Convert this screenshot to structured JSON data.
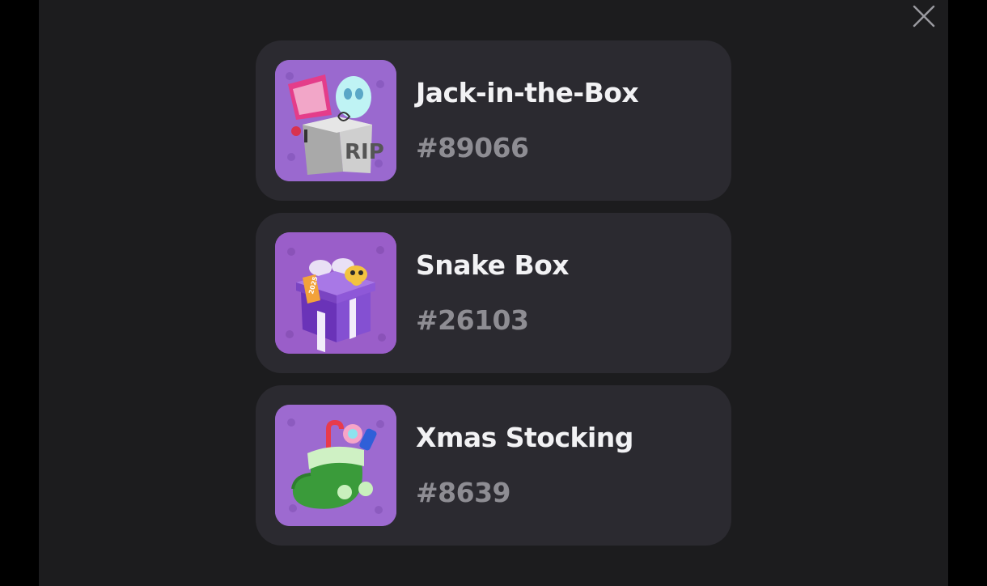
{
  "close": {
    "icon": "close-icon"
  },
  "items": [
    {
      "name": "Jack-in-the-Box",
      "id": "#89066",
      "icon": "jack-in-the-box-icon",
      "thumb_color": "#9a69cf",
      "rip_text": "RIP"
    },
    {
      "name": "Snake Box",
      "id": "#26103",
      "icon": "snake-box-icon",
      "thumb_color": "#9a69cf",
      "tag_text": "2025"
    },
    {
      "name": "Xmas Stocking",
      "id": "#8639",
      "icon": "xmas-stocking-icon",
      "thumb_color": "#9a69cf"
    }
  ],
  "colors": {
    "background": "#000000",
    "modal": "#1c1c1e",
    "card": "#2b2a30",
    "title": "#f2f2f4",
    "subtitle": "#8e8d93"
  }
}
